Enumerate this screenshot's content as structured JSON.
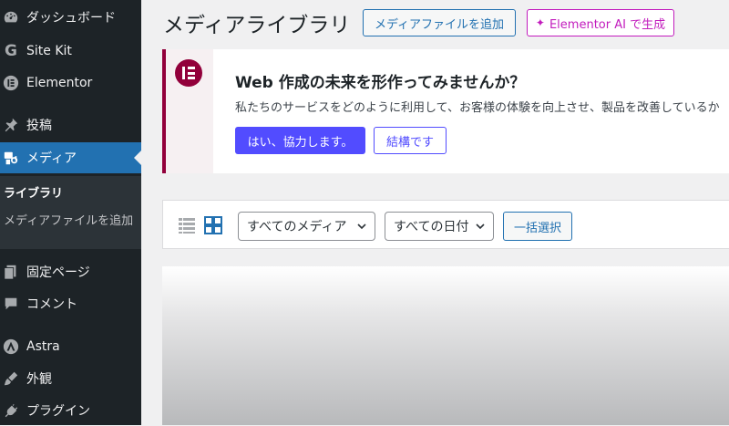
{
  "sidebar": {
    "items": [
      {
        "label": "ダッシュボード",
        "icon": "dashboard-icon"
      },
      {
        "label": "Site Kit",
        "icon": "sitekit-icon"
      },
      {
        "label": "Elementor",
        "icon": "elementor-icon"
      },
      {
        "label": "投稿",
        "icon": "pin-icon"
      },
      {
        "label": "メディア",
        "icon": "media-icon",
        "active": true
      },
      {
        "label": "固定ページ",
        "icon": "page-icon"
      },
      {
        "label": "コメント",
        "icon": "comment-icon"
      },
      {
        "label": "Astra",
        "icon": "astra-icon"
      },
      {
        "label": "外観",
        "icon": "appearance-icon"
      },
      {
        "label": "プラグイン",
        "icon": "plugin-icon"
      }
    ],
    "submenu": [
      {
        "label": "ライブラリ",
        "current": true
      },
      {
        "label": "メディアファイルを追加"
      }
    ]
  },
  "header": {
    "title": "メディアライブラリ",
    "add_button": "メディアファイルを追加",
    "ai_button": "Elementor AI で生成"
  },
  "notice": {
    "title": "Web 作成の未来を形作ってみませんか？",
    "text": "私たちのサービスをどのように利用して、お客様の体験を向上させ、製品を改善しているか",
    "primary_button": "はい、協力します。",
    "secondary_button": "結構です"
  },
  "toolbar": {
    "filter_media": "すべてのメディア",
    "filter_date": "すべての日付",
    "bulk_select": "一括選択"
  },
  "colors": {
    "sidebar_bg": "#1d2327",
    "accent": "#2271b1",
    "elementor": "#92003b",
    "primary_button": "#524cff",
    "ai": "#c21cbd"
  }
}
